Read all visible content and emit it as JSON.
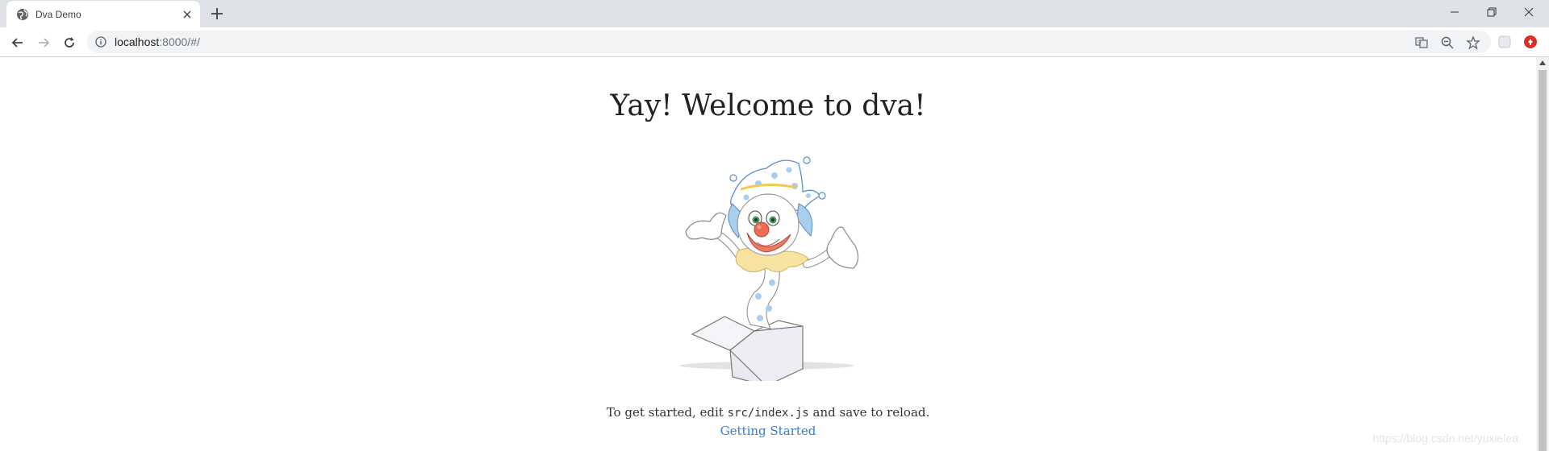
{
  "browser": {
    "tab": {
      "title": "Dva Demo"
    },
    "address": {
      "host": "localhost",
      "path": ":8000/#/"
    }
  },
  "page": {
    "heading": "Yay! Welcome to dva!",
    "intro_before": "To get started, edit ",
    "intro_code": "src/index.js",
    "intro_after": " and save to reload.",
    "link_label": "Getting Started"
  },
  "watermark": "https://blog.csdn.net/yuxielea",
  "colors": {
    "link": "#3b7bcc",
    "chrome_bg": "#dee1e6",
    "omnibox_bg": "#f1f3f4"
  },
  "icons": [
    "globe-icon",
    "close-icon",
    "plus-icon",
    "minimize-icon",
    "restore-icon",
    "close-window-icon",
    "back-arrow-icon",
    "forward-arrow-icon",
    "reload-icon",
    "info-icon",
    "translate-icon",
    "zoom-icon",
    "star-icon",
    "extension-icon",
    "adblock-icon"
  ]
}
